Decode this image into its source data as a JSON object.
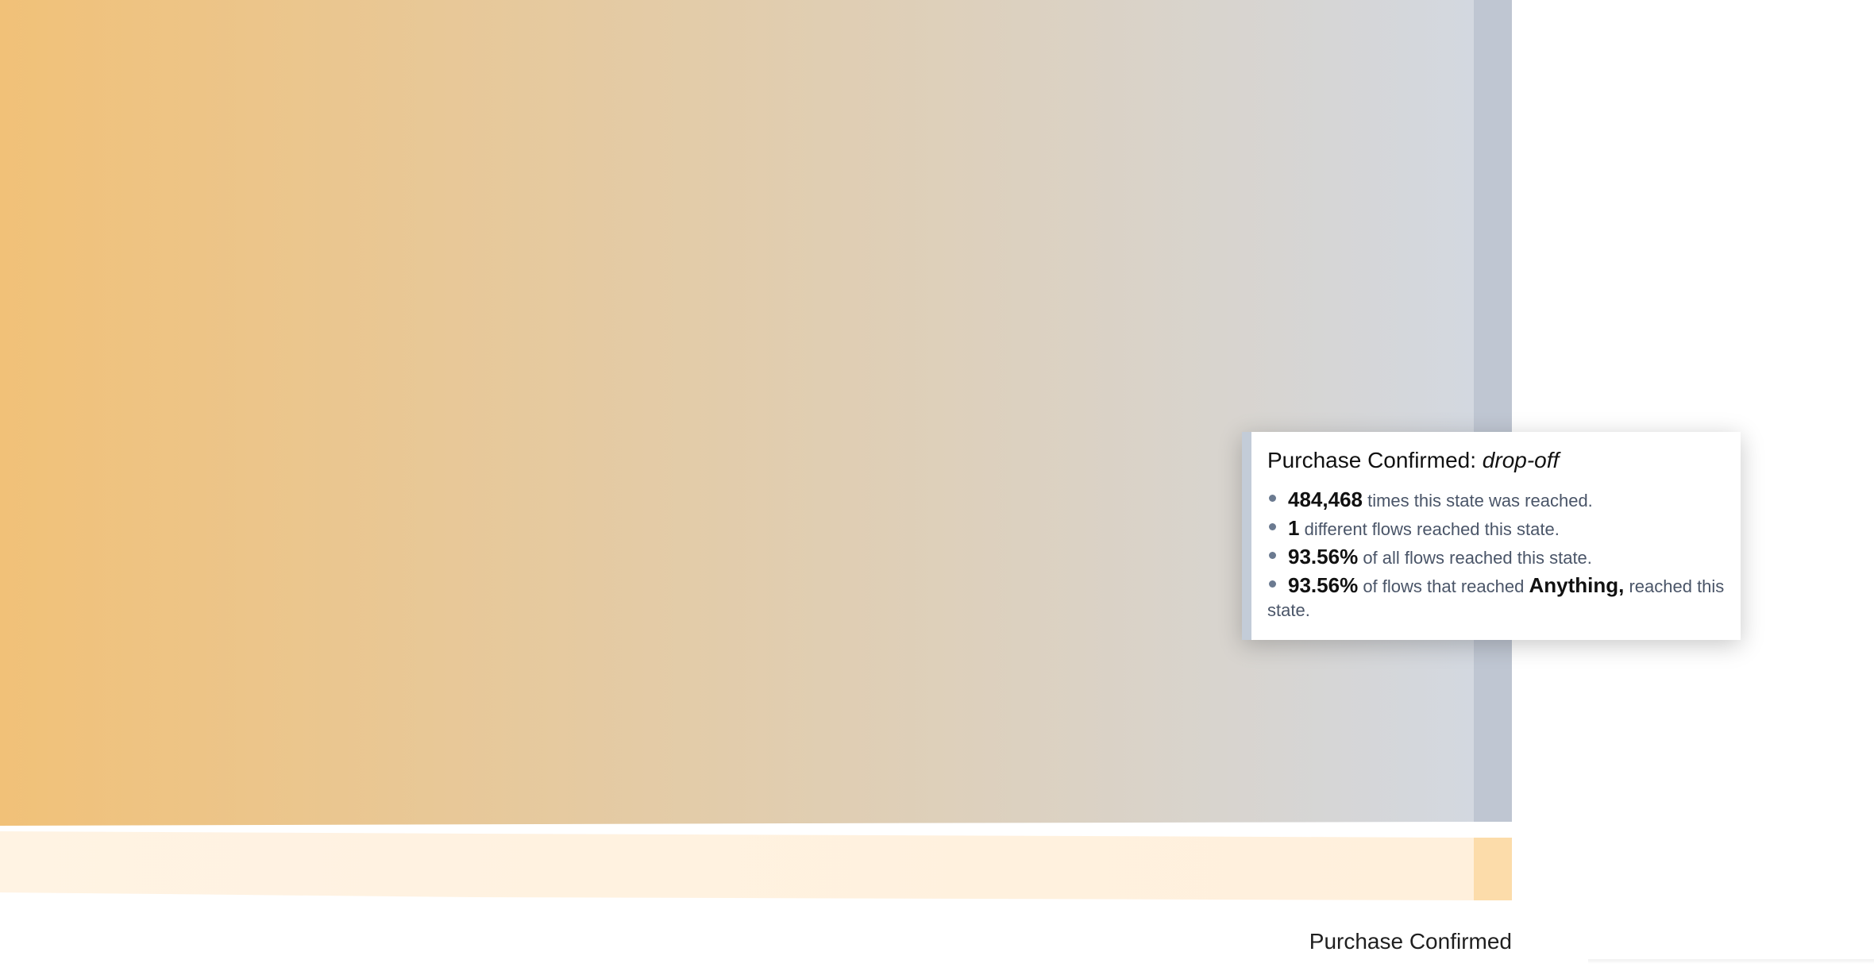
{
  "colors": {
    "flow_gradient_start": "#f1c178",
    "flow_gradient_end": "#d3d8e0",
    "dropoff_node": "#bfc6d2",
    "secondary_flow_start": "#fff3e3",
    "secondary_flow_end": "#fff0dc",
    "secondary_node": "#fcdcaa"
  },
  "node": {
    "label": "Purchase Confirmed"
  },
  "tooltip": {
    "state_name": "Purchase Confirmed:",
    "state_type": "drop-off",
    "stats": [
      {
        "value": "484,468",
        "text": "times this state was reached."
      },
      {
        "value": "1",
        "text": "different flows reached this state."
      },
      {
        "value": "93.56%",
        "text": "of all flows reached this state."
      },
      {
        "value": "93.56%",
        "text": "of flows that reached",
        "ref_state": "Anything,",
        "text_after": "reached this state."
      }
    ]
  }
}
